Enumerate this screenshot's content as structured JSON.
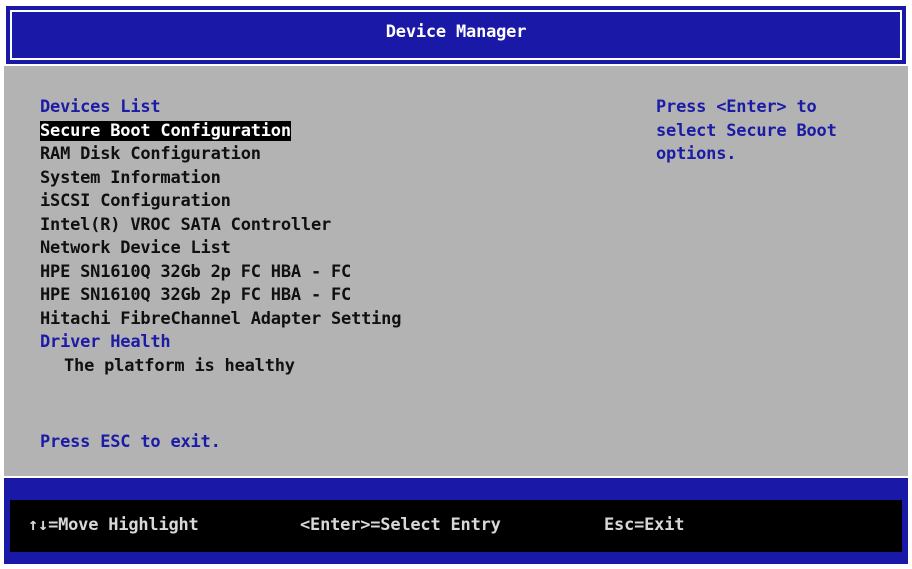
{
  "window": {
    "title": "Device Manager"
  },
  "menu": {
    "devices_header": "Devices List",
    "items": [
      "Secure Boot Configuration",
      "RAM Disk Configuration",
      "System Information",
      "iSCSI Configuration",
      "Intel(R) VROC SATA Controller",
      "Network Device List",
      "HPE SN1610Q 32Gb 2p FC HBA - FC",
      "HPE SN1610Q 32Gb 2p FC HBA - FC",
      "Hitachi FibreChannel Adapter Setting"
    ],
    "selected_index": 0,
    "driver_health_header": "Driver Health",
    "driver_health_status": "The platform is healthy",
    "exit_hint": "Press ESC to exit."
  },
  "help": {
    "text": "Press <Enter> to\nselect Secure Boot\noptions."
  },
  "footer": {
    "move": "↑↓=Move Highlight",
    "select": "<Enter>=Select Entry",
    "exit": "Esc=Exit"
  },
  "colors": {
    "title_bar": "#1a18a6",
    "background": "#b3b3b3",
    "accent_text": "#1b1ba6",
    "highlight": "#000000"
  }
}
